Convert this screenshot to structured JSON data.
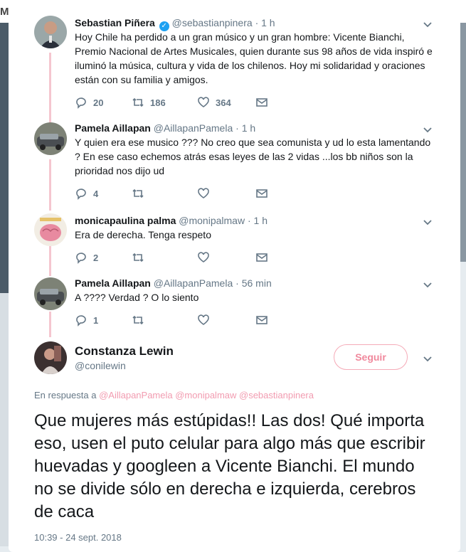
{
  "backdrop": {
    "letter": "M"
  },
  "colors": {
    "accent": "#f29bb0",
    "verified": "#1da1f2",
    "thread": "#f5c6cf"
  },
  "thread": [
    {
      "name": "Sebastian Piñera",
      "verified": true,
      "handle": "@sebastianpinera",
      "time": "1 h",
      "text": "Hoy Chile ha perdido a un gran músico y un gran hombre: Vicente Bianchi, Premio Nacional de Artes Musicales, quien durante sus 98 años de vida inspiró e iluminó la música, cultura y vida de los chilenos. Hoy mi solidaridad y oraciones están con su familia y amigos.",
      "replies": "20",
      "retweets": "186",
      "likes": "364"
    },
    {
      "name": "Pamela Aillapan",
      "handle": "@AillapanPamela",
      "time": "1 h",
      "text": "Y quien era ese musico ??? No creo que sea comunista y ud lo esta lamentando ? En ese caso echemos atrás esas leyes de las 2 vidas ...los bb niños son la prioridad nos dijo ud",
      "replies": "4",
      "retweets": "",
      "likes": ""
    },
    {
      "name": "monicapaulina palma",
      "handle": "@monipalmaw",
      "time": "1 h",
      "text": "Era de derecha. Tenga respeto",
      "replies": "2",
      "retweets": "",
      "likes": ""
    },
    {
      "name": "Pamela Aillapan",
      "handle": "@AillapanPamela",
      "time": "56 min",
      "text": "A ???? Verdad ? O lo siento",
      "replies": "1",
      "retweets": "",
      "likes": ""
    }
  ],
  "focus": {
    "name": "Constanza Lewin",
    "handle": "@conilewin",
    "follow_label": "Seguir",
    "reply_prefix": "En respuesta a",
    "mentions": "@AillapanPamela @monipalmaw @sebastianpinera",
    "text": "Que mujeres más estúpidas!! Las dos! Qué importa eso, usen el puto celular para algo más que escribir huevadas y googleen a Vicente Bianchi. El mundo no se divide sólo en derecha e izquierda, cerebros de caca",
    "timestamp": "10:39 - 24 sept. 2018"
  },
  "icons": {
    "reply": "reply-icon",
    "retweet": "retweet-icon",
    "like": "heart-icon",
    "dm": "envelope-icon",
    "menu": "chevron-down-icon"
  }
}
